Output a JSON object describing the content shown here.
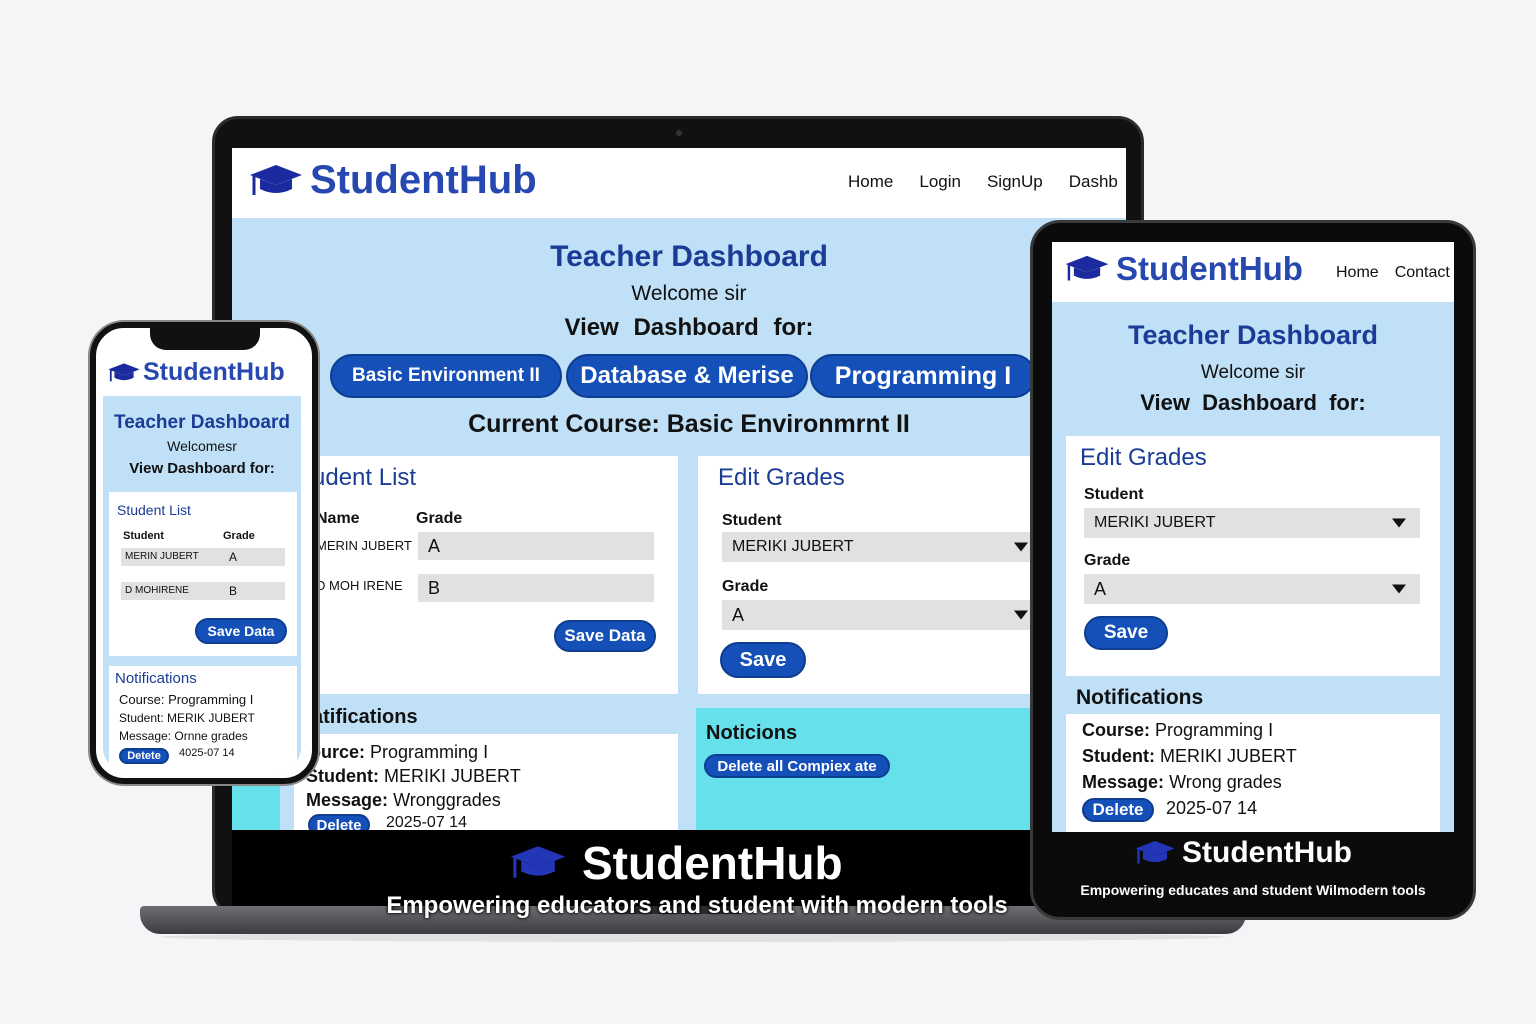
{
  "colors": {
    "brand_blue": "#2748b0",
    "button_blue": "#1550b8",
    "panel_bg": "#bfe0f6",
    "notice_bg": "#66e0ea"
  },
  "laptop": {
    "brand": "StudentHub",
    "nav": [
      "Home",
      "Login",
      "SignUp",
      "Dashb"
    ],
    "title": "Teacher Dashboard",
    "welcome": "Welcome sir",
    "view_label": "View Dashboard for:",
    "courses": [
      "Basic Environment II",
      "Database & Merise",
      "Programming I"
    ],
    "current_course": "Current Course: Basic Environmrnt II",
    "student_list": {
      "title": "udent List",
      "col_name": "Name",
      "col_grade": "Grade",
      "rows": [
        {
          "name": "MERIN JUBERT",
          "grade": "A"
        },
        {
          "name": "D MOH IRENE",
          "grade": "B"
        }
      ],
      "save_label": "Save Data"
    },
    "edit_grades": {
      "title": "Edit Grades",
      "student_label": "Student",
      "student_value": "MERIKI JUBERT",
      "grade_label": "Grade",
      "grade_value": "A",
      "save_label": "Save"
    },
    "notifications": {
      "title": "atifications",
      "course_key": "ource:",
      "course_val": "Programming I",
      "student_key": "Student:",
      "student_val": "MERIKI JUBERT",
      "message_key": "Message:",
      "message_val": "Wronggrades",
      "delete_label": "Delete",
      "date": "2025-07 14"
    },
    "notices": {
      "title": "Noticions",
      "delete_all_label": "Delete all Compiex ate"
    },
    "footer_brand": "StudentHub",
    "footer_tagline": "Empowering educators and student with modern tools"
  },
  "tablet": {
    "brand": "StudentHub",
    "nav": [
      "Home",
      "Contact"
    ],
    "title": "Teacher Dashboard",
    "welcome": "Welcome sir",
    "view_label": "View Dashboard for:",
    "edit_grades": {
      "title": "Edit Grades",
      "student_label": "Student",
      "student_value": "MERIKI JUBERT",
      "grade_label": "Grade",
      "grade_value": "A",
      "save_label": "Save"
    },
    "notifications": {
      "title": "Notifications",
      "course_key": "Course:",
      "course_val": "Programming I",
      "student_key": "Student:",
      "student_val": "MERIKI JUBERT",
      "message_key": "Message:",
      "message_val": "Wrong grades",
      "delete_label": "Delete",
      "date": "2025-07 14"
    },
    "footer_brand": "StudentHub",
    "footer_tagline": "Empowering educates and student Wilmodern tools"
  },
  "phone": {
    "brand": "StudentHub",
    "title": "Teacher Dashboard",
    "welcome": "Welcomesr",
    "view_label": "View Dashboard for:",
    "student_list": {
      "title": "Student List",
      "col_name": "Student",
      "col_grade": "Grade",
      "rows": [
        {
          "name": "MERIN JUBERT",
          "grade": "A"
        },
        {
          "name": "D MOHIRENE",
          "grade": "B"
        }
      ],
      "save_label": "Save Data"
    },
    "notifications": {
      "title": "Notifications",
      "course": "Course: Programming I",
      "student": "Student: MERIK JUBERT",
      "message": "Message: Ornne grades",
      "delete_label": "Detete",
      "date": "4025-07 14"
    }
  }
}
